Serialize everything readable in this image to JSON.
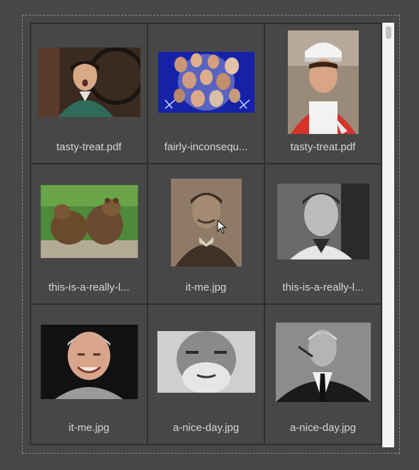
{
  "files": [
    {
      "name": "tasty-treat.pdf",
      "thumb_icon": "man-surprised-photo-icon"
    },
    {
      "name": "fairly-inconsequ...",
      "thumb_icon": "face-collage-photo-icon"
    },
    {
      "name": "tasty-treat.pdf",
      "thumb_icon": "man-paper-hat-photo-icon"
    },
    {
      "name": "this-is-a-really-l...",
      "thumb_icon": "bears-photo-icon"
    },
    {
      "name": "it-me.jpg",
      "thumb_icon": "vintage-portrait-photo-icon"
    },
    {
      "name": "this-is-a-really-l...",
      "thumb_icon": "man-bw-portrait-photo-icon"
    },
    {
      "name": "it-me.jpg",
      "thumb_icon": "man-smiling-photo-icon"
    },
    {
      "name": "a-nice-day.jpg",
      "thumb_icon": "man-bearded-photo-icon"
    },
    {
      "name": "a-nice-day.jpg",
      "thumb_icon": "man-suit-photo-icon"
    }
  ],
  "colors": {
    "background": "#474747",
    "tile_border": "#2e2e2e",
    "label_text": "#d6d6d6",
    "scrollbar": "#f4f4f4"
  }
}
